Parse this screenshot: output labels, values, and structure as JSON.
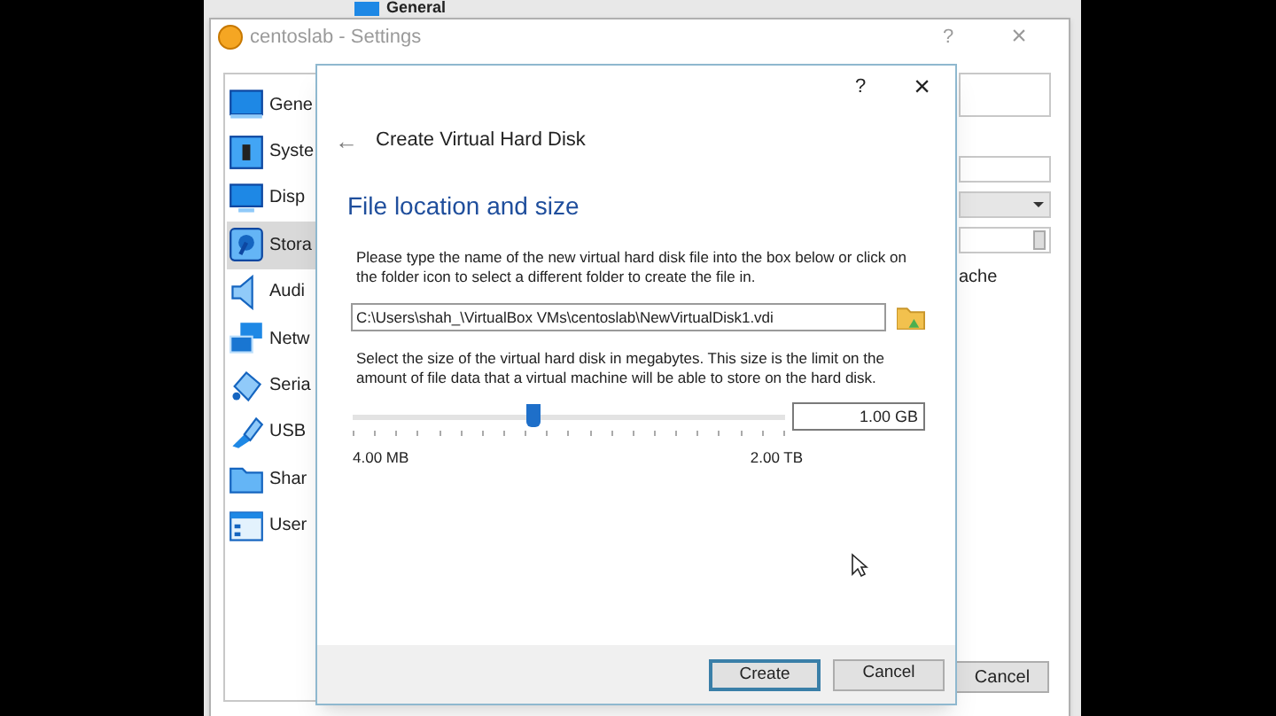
{
  "background_window": {
    "section": "General"
  },
  "settings_window": {
    "title": "centoslab - Settings",
    "help": "?",
    "close": "×",
    "sidebar": [
      {
        "label": "Gene",
        "kind": "general",
        "selected": false
      },
      {
        "label": "Syste",
        "kind": "system",
        "selected": false
      },
      {
        "label": "Disp",
        "kind": "display",
        "selected": false
      },
      {
        "label": "Stora",
        "kind": "storage",
        "selected": true
      },
      {
        "label": "Audi",
        "kind": "audio",
        "selected": false
      },
      {
        "label": "Netw",
        "kind": "network",
        "selected": false
      },
      {
        "label": "Seria",
        "kind": "serial",
        "selected": false
      },
      {
        "label": "USB",
        "kind": "usb",
        "selected": false
      },
      {
        "label": "Shar",
        "kind": "shared",
        "selected": false
      },
      {
        "label": "User",
        "kind": "user",
        "selected": false
      }
    ],
    "partial_label": "ache",
    "cancel_button": "Cancel"
  },
  "dialog": {
    "help": "?",
    "close": "×",
    "back": "←",
    "title": "Create Virtual Hard Disk",
    "heading": "File location and size",
    "location_text": "Please type the name of the new virtual hard disk file into the box below or click on the folder icon to select a different folder to create the file in.",
    "file_path": "C:\\Users\\shah_\\VirtualBox VMs\\centoslab\\NewVirtualDisk1.vdi",
    "size_text": "Select the size of the virtual hard disk in megabytes. This size is the limit on the amount of file data that a virtual machine will be able to store on the hard disk.",
    "size": {
      "level": 0.42,
      "value": "1.00 GB",
      "min_label": "4.00 MB",
      "max_label": "2.00 TB"
    },
    "buttons": [
      {
        "label": "Create",
        "default": true
      },
      {
        "label": "Cancel",
        "default": false
      }
    ]
  }
}
